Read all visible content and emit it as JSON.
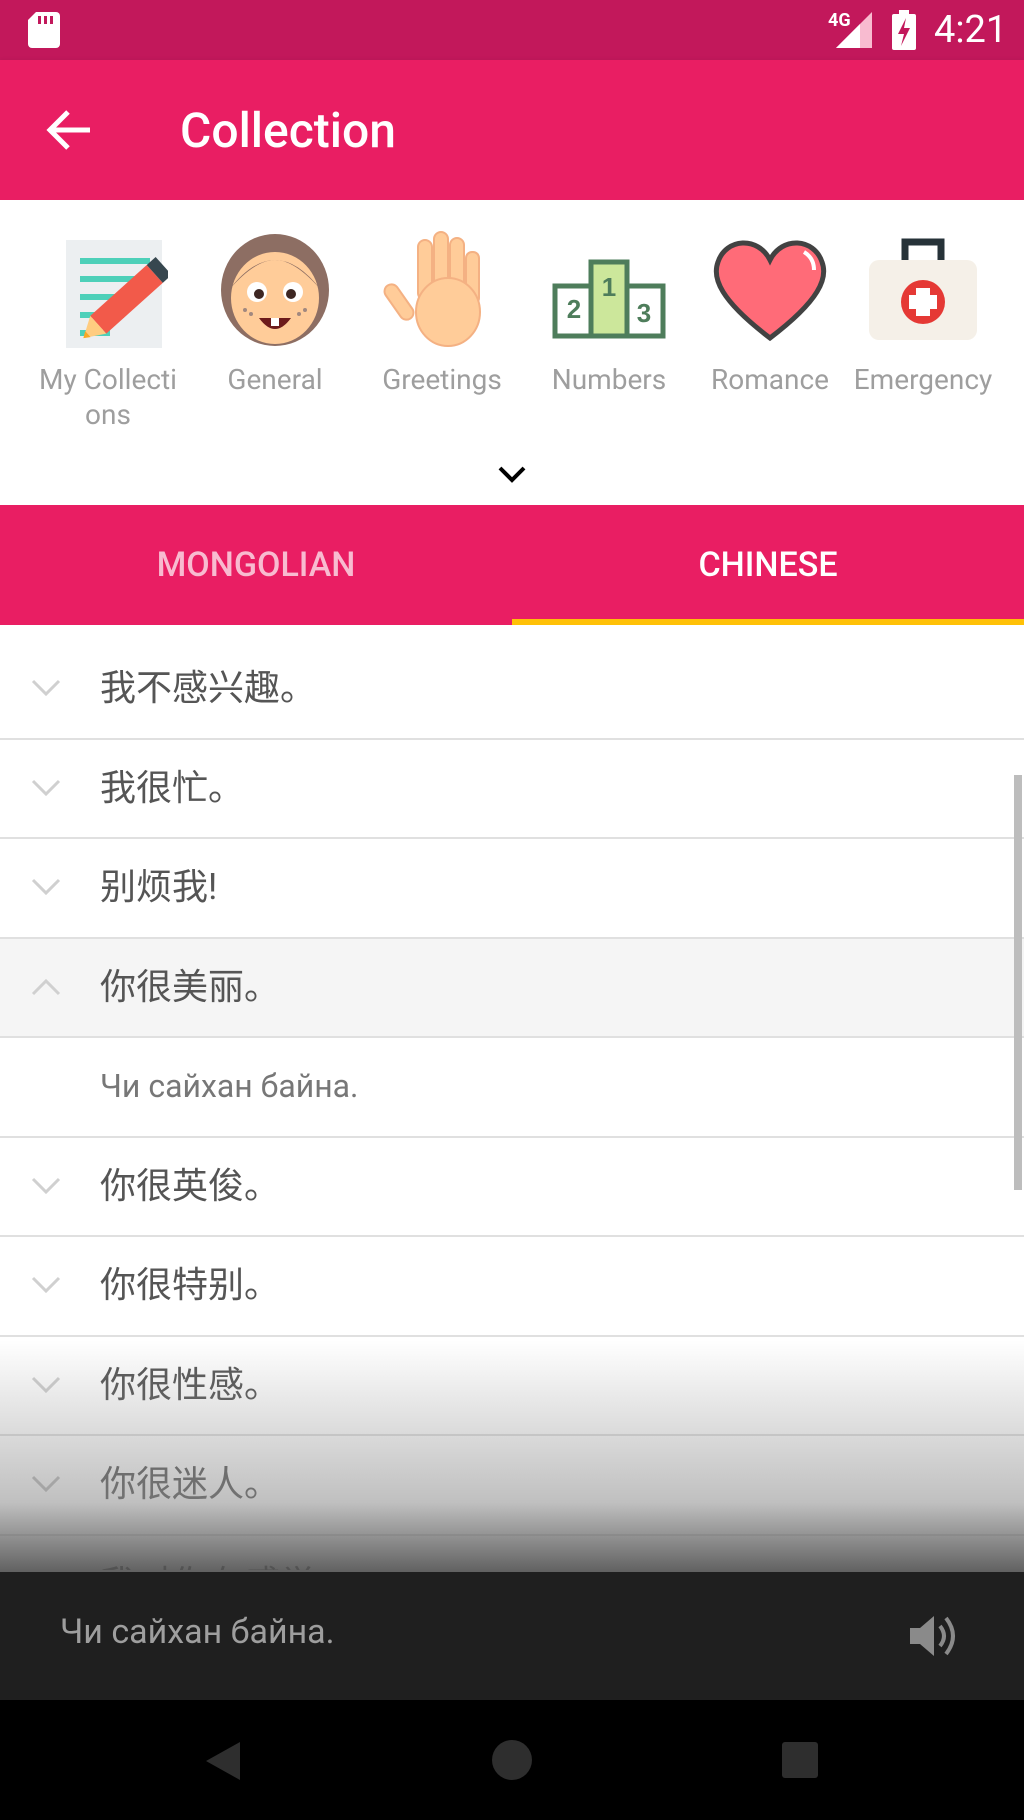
{
  "status_bar": {
    "network": "4G",
    "time": "4:21"
  },
  "app_bar": {
    "title": "Collection"
  },
  "categories": [
    {
      "label": "My Collections",
      "icon": "notepad-pencil-icon"
    },
    {
      "label": "General",
      "icon": "girl-face-icon"
    },
    {
      "label": "Greetings",
      "icon": "waving-hand-icon"
    },
    {
      "label": "Numbers",
      "icon": "podium-icon"
    },
    {
      "label": "Romance",
      "icon": "heart-icon"
    },
    {
      "label": "Emergency",
      "icon": "first-aid-kit-icon"
    }
  ],
  "tabs": [
    {
      "label": "MONGOLIAN",
      "selected": false
    },
    {
      "label": "CHINESE",
      "selected": true
    }
  ],
  "phrases": [
    {
      "text": "我不感兴趣。",
      "expanded": false
    },
    {
      "text": "我很忙。",
      "expanded": false
    },
    {
      "text": "别烦我!",
      "expanded": false
    },
    {
      "text": "你很美丽。",
      "expanded": true,
      "translation": "Чи сайхан байна."
    },
    {
      "text": "你很英俊。",
      "expanded": false
    },
    {
      "text": "你很特别。",
      "expanded": false
    },
    {
      "text": "你很性感。",
      "expanded": false
    },
    {
      "text": "你很迷人。",
      "expanded": false
    },
    {
      "text": "我对你有感觉。",
      "expanded": false
    }
  ],
  "player": {
    "text": "Чи сайхан байна."
  },
  "colors": {
    "status_bar": "#c2185b",
    "primary": "#e91e63",
    "tab_indicator": "#ffc107"
  }
}
